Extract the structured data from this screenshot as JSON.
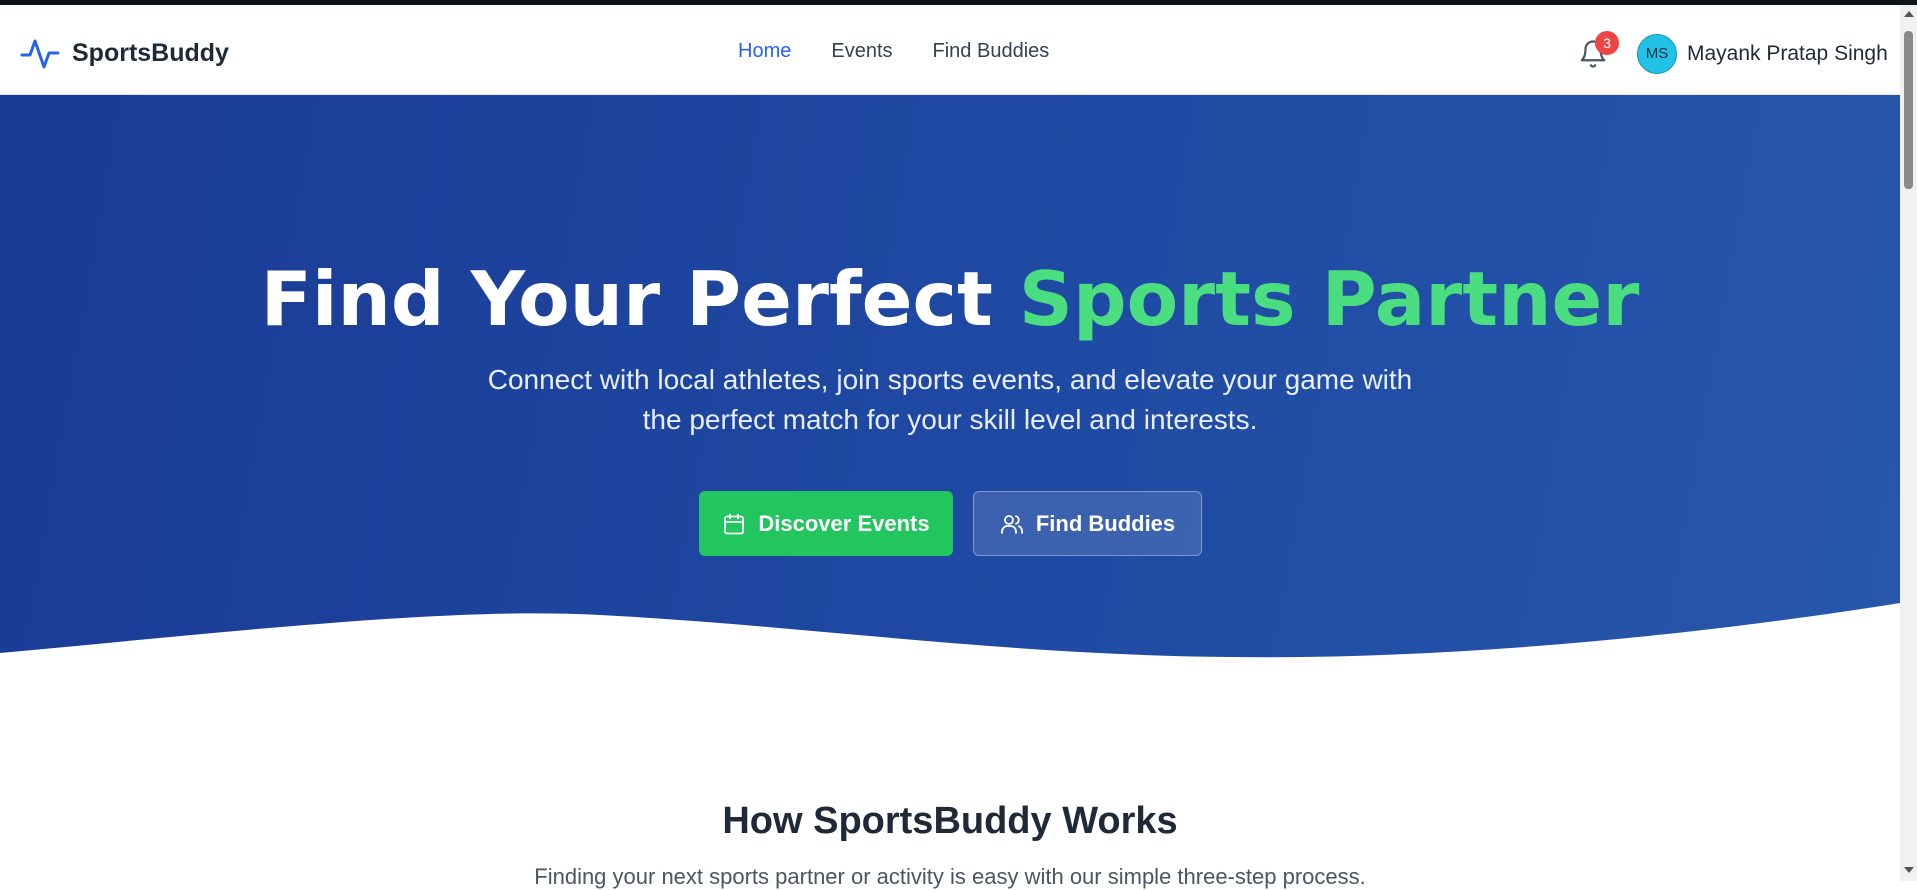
{
  "brand": {
    "name": "SportsBuddy",
    "logo_icon": "activity-pulse-icon",
    "color": "#2563eb"
  },
  "nav": {
    "items": [
      {
        "label": "Home",
        "active": true
      },
      {
        "label": "Events",
        "active": false
      },
      {
        "label": "Find Buddies",
        "active": false
      }
    ]
  },
  "notifications": {
    "icon": "bell-icon",
    "count": "3"
  },
  "user": {
    "initials": "MS",
    "name": "Mayank Pratap Singh"
  },
  "hero": {
    "title_main": "Find Your Perfect",
    "title_accent": "Sports Partner",
    "subtitle": "Connect with local athletes, join sports events, and elevate your game with the perfect match for your skill level and interests.",
    "primary_button": {
      "label": "Discover Events",
      "icon": "calendar-icon"
    },
    "secondary_button": {
      "label": "Find Buddies",
      "icon": "users-icon"
    },
    "accent_color": "#4ade80",
    "button_green": "#22c55e"
  },
  "how_it_works": {
    "title": "How SportsBuddy Works",
    "subtitle": "Finding your next sports partner or activity is easy with our simple three-step process."
  }
}
